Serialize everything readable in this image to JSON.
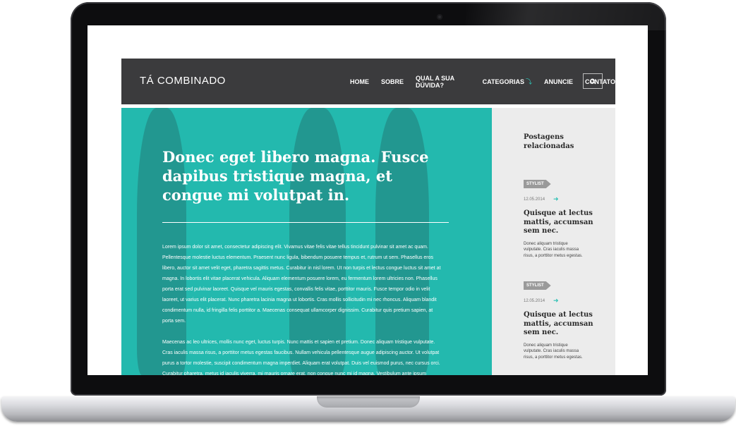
{
  "site": {
    "logo": "TÁ COMBINADO",
    "nav": [
      {
        "label": "HOME"
      },
      {
        "label": "SOBRE"
      },
      {
        "label": "QUAL A SUA DÚVIDA?"
      },
      {
        "label": "CATEGORIAS"
      },
      {
        "label": "ANUNCIE"
      },
      {
        "label": "CONTATO"
      }
    ],
    "search_icon": "search-icon",
    "accent": "#23b9ae",
    "header_bg": "#3b3b3d"
  },
  "article": {
    "title": "Donec eget libero magna. Fusce dapibus tristique magna, et congue mi volutpat in.",
    "paragraphs": [
      "Lorem ipsum dolor sit amet, consectetur adipiscing elit. Vivamus vitae felis vitae tellus tincidunt pulvinar sit amet ac quam. Pellentesque molestie luctus elementum. Praesent nunc ligula, bibendum posuere tempus et, rutrum ut sem. Phasellus eros libero, auctor sit amet velit eget, pharetra sagittis metus. Curabitur in nisl lorem. Ut non turpis et lectus congue luctus sit amet at magna. In lobortis elit vitae placerat vehicula. Aliquam elementum posuere lorem, eu fermentum lorem ultricies non. Phasellus porta erat sed pulvinar laoreet. Quisque vel mauris egestas, convallis felis vitae, porttitor mauris. Fusce tempor odio in velit laoreet, ut varius elit placerat. Nunc pharetra lacinia magna ut lobortis. Cras mollis sollicitudin mi nec rhoncus. Aliquam blandit condimentum nulla, id fringilla felis porttitor a. Maecenas consequat ullamcorper dignissim. Curabitur quis pretium sapien, at porta sem.",
      "Maecenas ac leo ultrices, mollis nunc eget, luctus turpis. Nunc mattis et sapien et pretium. Donec aliquam tristique vulputate. Cras iaculis massa risus, a porttitor metus egestas faucibus. Nullam vehicula pellentesque augue adipiscing auctor. Ut volutpat purus a tortor molestie, suscipit condimentum magna imperdiet. Aliquam erat volutpat. Duis vel euismod purus, nec cursus orci. Curabitur pharetra, metus id iaculis viverra, mi mauris ornare erat, non congue nunc mi id magna. Vestibulum ante ipsum"
    ]
  },
  "sidebar": {
    "title": "Postagens relacionadas",
    "posts": [
      {
        "tag": "STYLIST",
        "date": "12.05.2014",
        "title": "Quisque at lectus mattis, accumsan sem nec.",
        "excerpt": "Donec aliquam tristique vulputate. Cras iaculis massa risus, a porttitor metus egestas."
      },
      {
        "tag": "STYLIST",
        "date": "12.05.2014",
        "title": "Quisque at lectus mattis, accumsan sem nec.",
        "excerpt": "Donec aliquam tristique vulputate. Cras iaculis massa risus, a porttitor metus egestas."
      }
    ]
  }
}
